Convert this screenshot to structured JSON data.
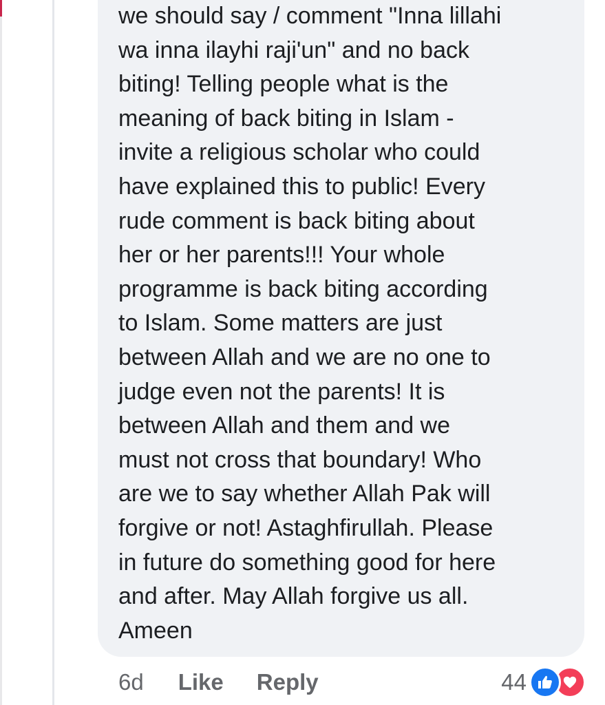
{
  "comment": {
    "text": "we should say / comment \"Inna lillahi\nwa inna ilayhi raji'un\" and no back\nbiting! Telling people what is the\nmeaning of back biting in Islam -\ninvite a religious scholar who could\nhave explained this to public! Every\nrude comment is back biting about\nher or her parents!!! Your whole\nprogramme is back biting according\nto Islam. Some matters are just\nbetween Allah and we are no one to\njudge even not the parents! It is\nbetween Allah and them and we\nmust not cross that boundary! Who\nare we to say whether Allah Pak will\nforgive or not! Astaghfirullah. Please\nin future do something good for here\nand after. May Allah forgive us all.\nAmeen"
  },
  "actions": {
    "time": "6d",
    "like_label": "Like",
    "reply_label": "Reply"
  },
  "reactions": {
    "count": "44",
    "icons": [
      "thumbs-up-icon",
      "heart-icon"
    ],
    "colors": {
      "like": "#1877f2",
      "love": "#f33e58"
    }
  },
  "colors": {
    "bubble_background": "#f0f2f5",
    "text": "#1c1e21",
    "meta_text": "#65676b"
  }
}
